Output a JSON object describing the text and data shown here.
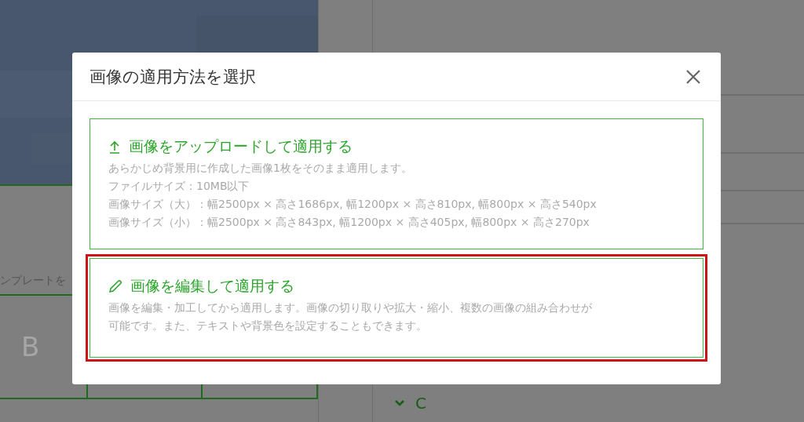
{
  "background": {
    "side_label": "ンプレートを",
    "grid_first_cell": "B",
    "section": {
      "label": "C",
      "expanded": true
    }
  },
  "dialog": {
    "title": "画像の適用方法を選択",
    "options": [
      {
        "kind": "upload",
        "title": "画像をアップロードして適用する",
        "highlighted": false,
        "lines": [
          "あらかじめ背景用に作成した画像1枚をそのまま適用します。",
          "ファイルサイズ：10MB以下",
          "画像サイズ（大）：幅2500px × 高さ1686px, 幅1200px × 高さ810px, 幅800px × 高さ540px",
          "画像サイズ（小）：幅2500px × 高さ843px, 幅1200px × 高さ405px, 幅800px × 高さ270px"
        ]
      },
      {
        "kind": "edit",
        "title": "画像を編集して適用する",
        "highlighted": true,
        "lines": [
          "画像を編集・加工してから適用します。画像の切り取りや拡大・縮小、複数の画像の組み合わせが",
          "可能です。また、テキストや背景色を設定することもできます。"
        ]
      }
    ]
  }
}
